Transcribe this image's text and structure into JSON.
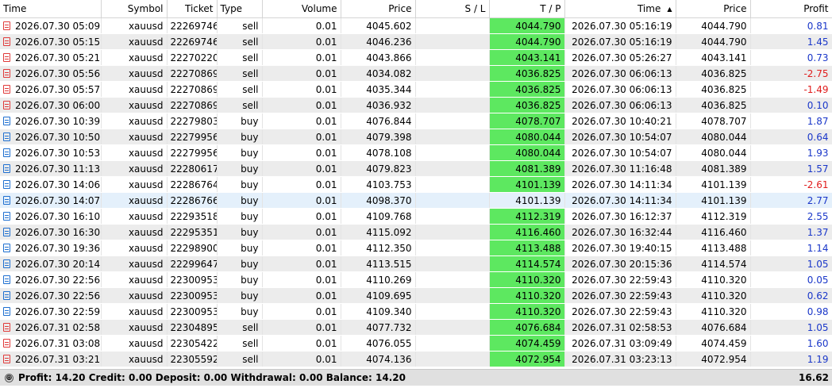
{
  "columns": [
    "Time",
    "Symbol",
    "Ticket",
    "Type",
    "Volume",
    "Price",
    "S / L",
    "T / P",
    "Time",
    "Price",
    "Profit"
  ],
  "sort_indicator": "▲",
  "rows": [
    {
      "open_time": "2026.07.30 05:09...",
      "symbol": "xauusd",
      "ticket": "22269746...",
      "type": "sell",
      "volume": "0.01",
      "open_price": "4045.602",
      "sl": "",
      "tp": "4044.790",
      "close_time": "2026.07.30 05:16:19",
      "close_price": "4044.790",
      "profit": "0.81",
      "tp_hit": true
    },
    {
      "open_time": "2026.07.30 05:15...",
      "symbol": "xauusd",
      "ticket": "22269746...",
      "type": "sell",
      "volume": "0.01",
      "open_price": "4046.236",
      "sl": "",
      "tp": "4044.790",
      "close_time": "2026.07.30 05:16:19",
      "close_price": "4044.790",
      "profit": "1.45",
      "tp_hit": true
    },
    {
      "open_time": "2026.07.30 05:21...",
      "symbol": "xauusd",
      "ticket": "22270220...",
      "type": "sell",
      "volume": "0.01",
      "open_price": "4043.866",
      "sl": "",
      "tp": "4043.141",
      "close_time": "2026.07.30 05:26:27",
      "close_price": "4043.141",
      "profit": "0.73",
      "tp_hit": true
    },
    {
      "open_time": "2026.07.30 05:56...",
      "symbol": "xauusd",
      "ticket": "22270869...",
      "type": "sell",
      "volume": "0.01",
      "open_price": "4034.082",
      "sl": "",
      "tp": "4036.825",
      "close_time": "2026.07.30 06:06:13",
      "close_price": "4036.825",
      "profit": "-2.75",
      "tp_hit": true
    },
    {
      "open_time": "2026.07.30 05:57...",
      "symbol": "xauusd",
      "ticket": "22270869...",
      "type": "sell",
      "volume": "0.01",
      "open_price": "4035.344",
      "sl": "",
      "tp": "4036.825",
      "close_time": "2026.07.30 06:06:13",
      "close_price": "4036.825",
      "profit": "-1.49",
      "tp_hit": true
    },
    {
      "open_time": "2026.07.30 06:00...",
      "symbol": "xauusd",
      "ticket": "22270869...",
      "type": "sell",
      "volume": "0.01",
      "open_price": "4036.932",
      "sl": "",
      "tp": "4036.825",
      "close_time": "2026.07.30 06:06:13",
      "close_price": "4036.825",
      "profit": "0.10",
      "tp_hit": true
    },
    {
      "open_time": "2026.07.30 10:39...",
      "symbol": "xauusd",
      "ticket": "22279803...",
      "type": "buy",
      "volume": "0.01",
      "open_price": "4076.844",
      "sl": "",
      "tp": "4078.707",
      "close_time": "2026.07.30 10:40:21",
      "close_price": "4078.707",
      "profit": "1.87",
      "tp_hit": true
    },
    {
      "open_time": "2026.07.30 10:50...",
      "symbol": "xauusd",
      "ticket": "22279956...",
      "type": "buy",
      "volume": "0.01",
      "open_price": "4079.398",
      "sl": "",
      "tp": "4080.044",
      "close_time": "2026.07.30 10:54:07",
      "close_price": "4080.044",
      "profit": "0.64",
      "tp_hit": true
    },
    {
      "open_time": "2026.07.30 10:53...",
      "symbol": "xauusd",
      "ticket": "22279956...",
      "type": "buy",
      "volume": "0.01",
      "open_price": "4078.108",
      "sl": "",
      "tp": "4080.044",
      "close_time": "2026.07.30 10:54:07",
      "close_price": "4080.044",
      "profit": "1.93",
      "tp_hit": true
    },
    {
      "open_time": "2026.07.30 11:13...",
      "symbol": "xauusd",
      "ticket": "22280617...",
      "type": "buy",
      "volume": "0.01",
      "open_price": "4079.823",
      "sl": "",
      "tp": "4081.389",
      "close_time": "2026.07.30 11:16:48",
      "close_price": "4081.389",
      "profit": "1.57",
      "tp_hit": true
    },
    {
      "open_time": "2026.07.30 14:06...",
      "symbol": "xauusd",
      "ticket": "22286764...",
      "type": "buy",
      "volume": "0.01",
      "open_price": "4103.753",
      "sl": "",
      "tp": "4101.139",
      "close_time": "2026.07.30 14:11:34",
      "close_price": "4101.139",
      "profit": "-2.61",
      "tp_hit": true
    },
    {
      "open_time": "2026.07.30 14:07...",
      "symbol": "xauusd",
      "ticket": "22286766...",
      "type": "buy",
      "volume": "0.01",
      "open_price": "4098.370",
      "sl": "",
      "tp": "4101.139",
      "close_time": "2026.07.30 14:11:34",
      "close_price": "4101.139",
      "profit": "2.77",
      "tp_hit": false,
      "selected": true
    },
    {
      "open_time": "2026.07.30 16:10...",
      "symbol": "xauusd",
      "ticket": "22293518...",
      "type": "buy",
      "volume": "0.01",
      "open_price": "4109.768",
      "sl": "",
      "tp": "4112.319",
      "close_time": "2026.07.30 16:12:37",
      "close_price": "4112.319",
      "profit": "2.55",
      "tp_hit": true
    },
    {
      "open_time": "2026.07.30 16:30...",
      "symbol": "xauusd",
      "ticket": "22295351...",
      "type": "buy",
      "volume": "0.01",
      "open_price": "4115.092",
      "sl": "",
      "tp": "4116.460",
      "close_time": "2026.07.30 16:32:44",
      "close_price": "4116.460",
      "profit": "1.37",
      "tp_hit": true
    },
    {
      "open_time": "2026.07.30 19:36...",
      "symbol": "xauusd",
      "ticket": "22298900...",
      "type": "buy",
      "volume": "0.01",
      "open_price": "4112.350",
      "sl": "",
      "tp": "4113.488",
      "close_time": "2026.07.30 19:40:15",
      "close_price": "4113.488",
      "profit": "1.14",
      "tp_hit": true
    },
    {
      "open_time": "2026.07.30 20:14...",
      "symbol": "xauusd",
      "ticket": "22299647...",
      "type": "buy",
      "volume": "0.01",
      "open_price": "4113.515",
      "sl": "",
      "tp": "4114.574",
      "close_time": "2026.07.30 20:15:36",
      "close_price": "4114.574",
      "profit": "1.05",
      "tp_hit": true
    },
    {
      "open_time": "2026.07.30 22:56...",
      "symbol": "xauusd",
      "ticket": "22300953...",
      "type": "buy",
      "volume": "0.01",
      "open_price": "4110.269",
      "sl": "",
      "tp": "4110.320",
      "close_time": "2026.07.30 22:59:43",
      "close_price": "4110.320",
      "profit": "0.05",
      "tp_hit": true
    },
    {
      "open_time": "2026.07.30 22:56...",
      "symbol": "xauusd",
      "ticket": "22300953...",
      "type": "buy",
      "volume": "0.01",
      "open_price": "4109.695",
      "sl": "",
      "tp": "4110.320",
      "close_time": "2026.07.30 22:59:43",
      "close_price": "4110.320",
      "profit": "0.62",
      "tp_hit": true
    },
    {
      "open_time": "2026.07.30 22:59...",
      "symbol": "xauusd",
      "ticket": "22300953...",
      "type": "buy",
      "volume": "0.01",
      "open_price": "4109.340",
      "sl": "",
      "tp": "4110.320",
      "close_time": "2026.07.30 22:59:43",
      "close_price": "4110.320",
      "profit": "0.98",
      "tp_hit": true
    },
    {
      "open_time": "2026.07.31 02:58...",
      "symbol": "xauusd",
      "ticket": "22304895...",
      "type": "sell",
      "volume": "0.01",
      "open_price": "4077.732",
      "sl": "",
      "tp": "4076.684",
      "close_time": "2026.07.31 02:58:53",
      "close_price": "4076.684",
      "profit": "1.05",
      "tp_hit": true
    },
    {
      "open_time": "2026.07.31 03:08...",
      "symbol": "xauusd",
      "ticket": "22305422...",
      "type": "sell",
      "volume": "0.01",
      "open_price": "4076.055",
      "sl": "",
      "tp": "4074.459",
      "close_time": "2026.07.31 03:09:49",
      "close_price": "4074.459",
      "profit": "1.60",
      "tp_hit": true
    },
    {
      "open_time": "2026.07.31 03:21...",
      "symbol": "xauusd",
      "ticket": "22305592...",
      "type": "sell",
      "volume": "0.01",
      "open_price": "4074.136",
      "sl": "",
      "tp": "4072.954",
      "close_time": "2026.07.31 03:23:13",
      "close_price": "4072.954",
      "profit": "1.19",
      "tp_hit": true
    }
  ],
  "footer": {
    "expand_icon": "⊕",
    "summary": "Profit: 14.20  Credit: 0.00  Deposit: 0.00  Withdrawal: 0.00  Balance: 14.20",
    "total": "16.62"
  },
  "colors": {
    "tp_highlight": "#5de860",
    "positive_profit": "#1a37c9",
    "negative_profit": "#e01c1c",
    "sell_icon": "#e03a3a",
    "buy_icon": "#1e6fd0"
  }
}
